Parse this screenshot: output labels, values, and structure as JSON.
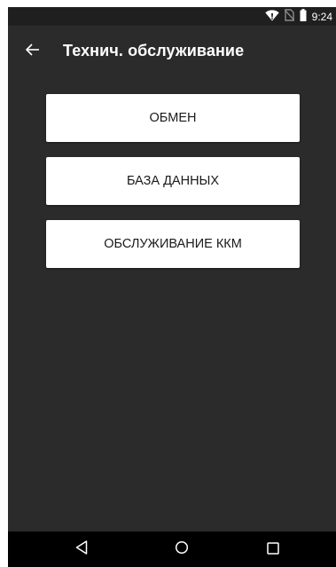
{
  "status_bar": {
    "time": "9:24",
    "icons": [
      "wifi-icon",
      "no-sim-icon",
      "battery-icon"
    ]
  },
  "app_bar": {
    "back_icon": "arrow-left-icon",
    "title": "Технич. обслуживание"
  },
  "menu": {
    "items": [
      {
        "label": "ОБМЕН"
      },
      {
        "label": "БАЗА ДАННЫХ"
      },
      {
        "label": "ОБСЛУЖИВАНИЕ ККМ"
      }
    ]
  },
  "nav_bar": {
    "icons": [
      "nav-back-icon",
      "nav-home-icon",
      "nav-recents-icon"
    ]
  },
  "colors": {
    "background": "#2b2b2b",
    "status_bar": "#1f1f1f",
    "nav_bar": "#000000",
    "button_bg": "#ffffff",
    "button_text": "#1a1a1a",
    "title_text": "#ffffff"
  }
}
